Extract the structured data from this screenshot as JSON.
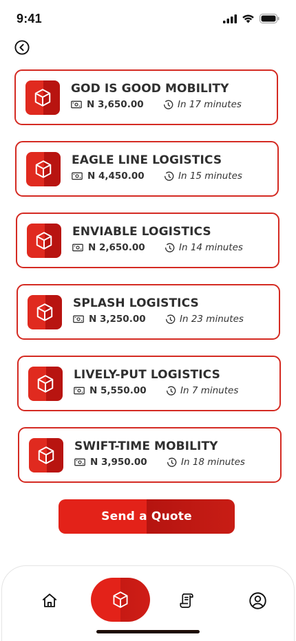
{
  "status_bar": {
    "time": "9:41"
  },
  "quotes": [
    {
      "name": "GOD IS GOOD MOBILITY",
      "price": "N 3,650.00",
      "eta": "In 17 minutes"
    },
    {
      "name": "EAGLE LINE LOGISTICS",
      "price": "N 4,450.00",
      "eta": "In 15 minutes"
    },
    {
      "name": "ENVIABLE LOGISTICS",
      "price": "N 2,650.00",
      "eta": "In 14 minutes"
    },
    {
      "name": "SPLASH LOGISTICS",
      "price": "N 3,250.00",
      "eta": "In 23 minutes"
    },
    {
      "name": "LIVELY-PUT LOGISTICS",
      "price": "N 5,550.00",
      "eta": "In 7 minutes"
    },
    {
      "name": "SWIFT-TIME MOBILITY",
      "price": "N 3,950.00",
      "eta": "In 18 minutes"
    }
  ],
  "actions": {
    "send_quote_label": "Send a Quote"
  },
  "colors": {
    "accent": "#d42a22",
    "accent_dark": "#b51410",
    "text": "#2f2f2f"
  },
  "bottom_nav": {
    "items": [
      {
        "icon": "home-icon"
      },
      {
        "icon": "box-icon",
        "active": true
      },
      {
        "icon": "receipt-icon"
      },
      {
        "icon": "profile-icon"
      }
    ]
  }
}
